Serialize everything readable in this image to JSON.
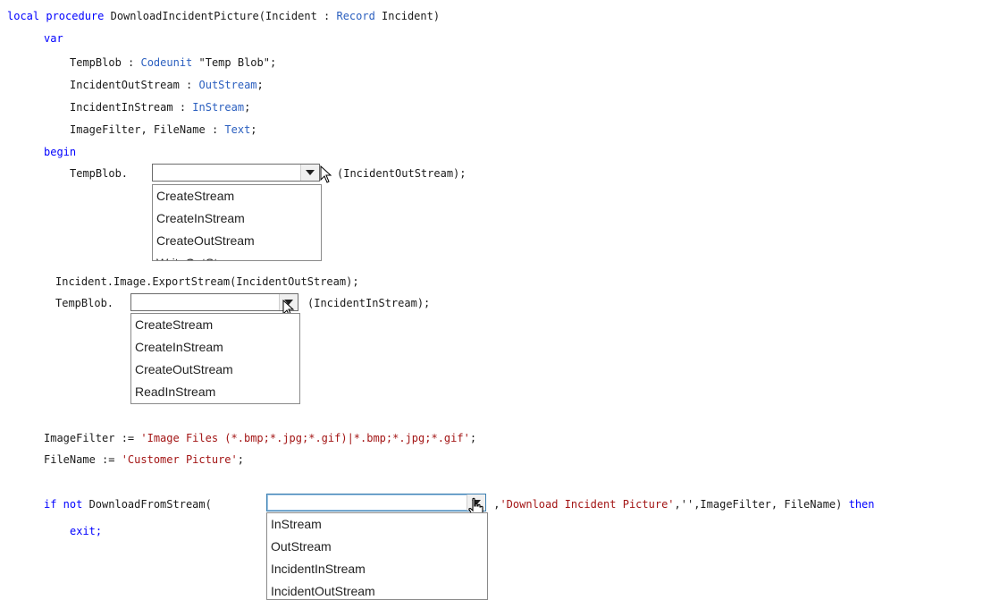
{
  "code": {
    "line1": {
      "kw": "local procedure",
      "name": " DownloadIncidentPicture(Incident : ",
      "type": "Record",
      "rest": " Incident)"
    },
    "var_kw": "var",
    "decl1": {
      "name": "TempBlob : ",
      "type": "Codeunit",
      "rest": " \"Temp Blob\";"
    },
    "decl2": {
      "name": "IncidentOutStream : ",
      "type": "OutStream",
      "rest": ";"
    },
    "decl3": {
      "name": "IncidentInStream : ",
      "type": "InStream",
      "rest": ";"
    },
    "decl4": {
      "name": "ImageFilter, FileName : ",
      "type": "Text",
      "rest": ";"
    },
    "begin_kw": "begin",
    "tempblob1_prefix": "TempBlob.",
    "tempblob1_suffix": "(IncidentOutStream);",
    "export_line": "Incident.Image.ExportStream(IncidentOutStream);",
    "tempblob2_prefix": "TempBlob.",
    "tempblob2_suffix": "(IncidentInStream);",
    "imagefilter": {
      "lhs": "ImageFilter := ",
      "str": "'Image Files (*.bmp;*.jpg;*.gif)|*.bmp;*.jpg;*.gif'",
      "end": ";"
    },
    "filename": {
      "lhs": "FileName := ",
      "str": "'Customer Picture'",
      "end": ";"
    },
    "if_line": {
      "kw": "if not",
      "call": " DownloadFromStream(",
      "sep": " ,",
      "str": "'Download Incident Picture'",
      "rest": ",'',ImageFilter, FileName)",
      "then": " then"
    },
    "exit_line": "exit;"
  },
  "dropdown1": {
    "items": [
      "CreateStream",
      "CreateInStream",
      "CreateOutStream",
      "WriteOutStream"
    ]
  },
  "dropdown2": {
    "items": [
      "CreateStream",
      "CreateInStream",
      "CreateOutStream",
      "ReadInStream"
    ]
  },
  "dropdown3": {
    "items": [
      "InStream",
      "OutStream",
      "IncidentInStream",
      "IncidentOutStream"
    ]
  },
  "icons": [
    "caret-down-icon",
    "mouse-pointer-icon",
    "hand-pointer-icon"
  ]
}
